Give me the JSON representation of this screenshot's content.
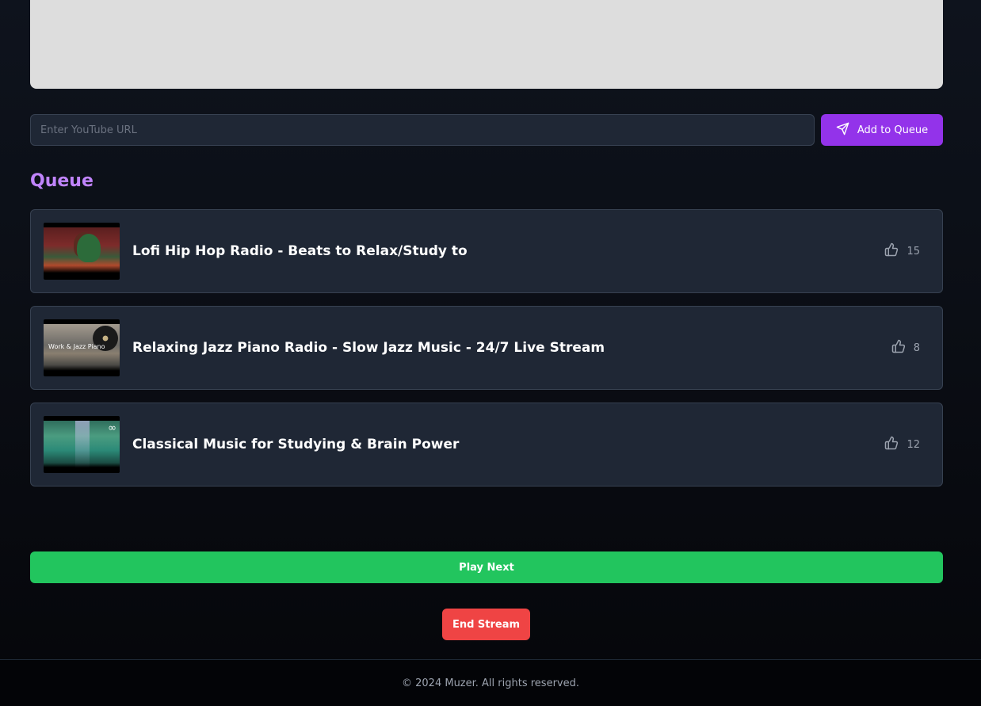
{
  "url_input": {
    "placeholder": "Enter YouTube URL",
    "value": ""
  },
  "add_button": {
    "label": "Add to Queue",
    "icon": "send-icon"
  },
  "queue": {
    "title": "Queue",
    "items": [
      {
        "title": "Lofi Hip Hop Radio - Beats to Relax/Study to",
        "votes": "15"
      },
      {
        "title": "Relaxing Jazz Piano Radio - Slow Jazz Music - 24/7 Live Stream",
        "votes": "8",
        "thumb_text": "Work & Jazz Piano"
      },
      {
        "title": "Classical Music for Studying & Brain Power",
        "votes": "12",
        "thumb_text": "∞"
      }
    ]
  },
  "play_next": {
    "label": "Play Next"
  },
  "end_stream": {
    "label": "End Stream"
  },
  "footer": {
    "text": "© 2024 Muzer. All rights reserved."
  },
  "colors": {
    "accent": "#9333ea",
    "queue_title": "#c084fc",
    "play_next": "#22c55e",
    "end_stream": "#ef4444",
    "card_bg": "#1f2735"
  }
}
